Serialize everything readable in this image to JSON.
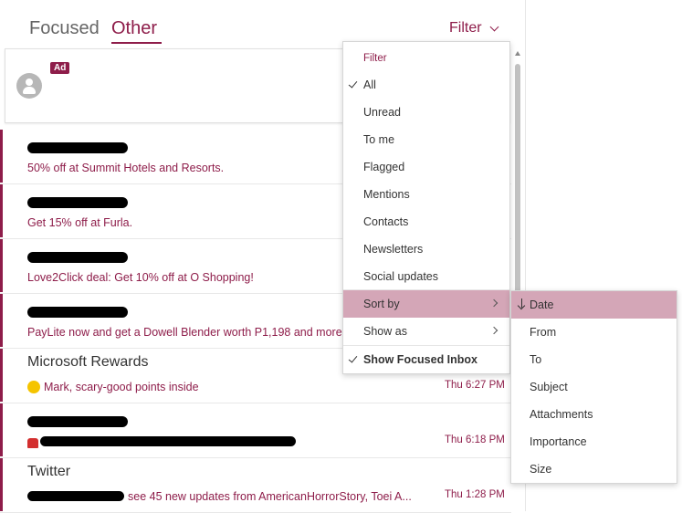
{
  "tabs": {
    "focused": "Focused",
    "other": "Other"
  },
  "filter_button": {
    "label": "Filter"
  },
  "ad": {
    "badge": "Ad"
  },
  "emails": [
    {
      "sender": "",
      "preview": "50% off at Summit Hotels and Resorts.",
      "time": ""
    },
    {
      "sender": "",
      "preview": "Get 15% off at Furla.",
      "time": ""
    },
    {
      "sender": "",
      "preview": "Love2Click deal: Get 10% off at O Shopping!",
      "time": ""
    },
    {
      "sender": "",
      "preview": "PayLite now and get a Dowell Blender worth P1,198 and more!",
      "time": ""
    },
    {
      "sender": "Microsoft Rewards",
      "preview": "Mark, scary-good points inside",
      "time": "Thu 6:27 PM"
    },
    {
      "sender": "",
      "preview": "",
      "time": "Thu 6:18 PM"
    },
    {
      "sender": "Twitter",
      "preview": "see 45 new updates from AmericanHorrorStory, Toei A...",
      "time": "Thu 1:28 PM"
    }
  ],
  "filter_menu": {
    "header": "Filter",
    "items": [
      {
        "label": "All"
      },
      {
        "label": "Unread"
      },
      {
        "label": "To me"
      },
      {
        "label": "Flagged"
      },
      {
        "label": "Mentions"
      },
      {
        "label": "Contacts"
      },
      {
        "label": "Newsletters"
      },
      {
        "label": "Social updates"
      }
    ],
    "sort_by": "Sort by",
    "show_as": "Show as",
    "show_focused": "Show Focused Inbox"
  },
  "sort_menu": {
    "items": [
      {
        "label": "Date"
      },
      {
        "label": "From"
      },
      {
        "label": "To"
      },
      {
        "label": "Subject"
      },
      {
        "label": "Attachments"
      },
      {
        "label": "Importance"
      },
      {
        "label": "Size"
      }
    ]
  },
  "colors": {
    "accent": "#8e1d4a",
    "highlight": "#d4a6b7"
  }
}
